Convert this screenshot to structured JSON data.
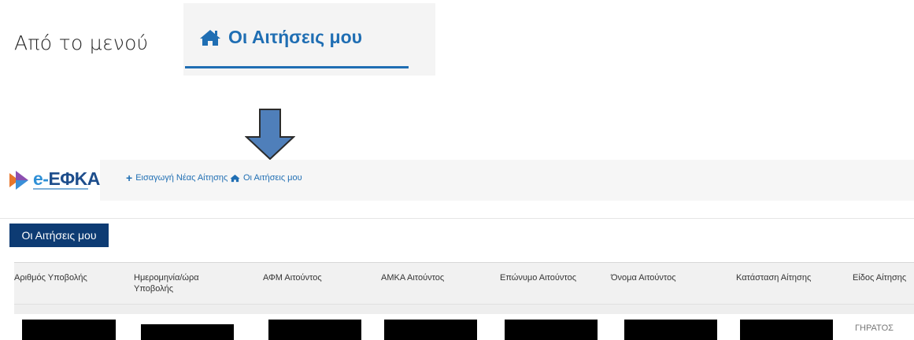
{
  "intro": {
    "text": "Από το μενού"
  },
  "zoom": {
    "label": "Οι Αιτήσεις μου"
  },
  "brand": {
    "logo_e": "e-",
    "logo_text": "ΕΦΚΑ"
  },
  "nav": {
    "new_application": "Εισαγωγή Νέας Αίτησης",
    "my_applications": "Οι Αιτήσεις μου"
  },
  "section": {
    "title_button": "Οι Αιτήσεις μου"
  },
  "table": {
    "headers": [
      "Αριθμός Υποβολής",
      "Ημερομηνία/ώρα Υποβολής",
      "ΑΦΜ Αιτούντος",
      "ΑΜΚΑ Αιτούντος",
      "Επώνυμο Αιτούντος",
      "Όνομα Αιτούντος",
      "Κατάσταση Αίτησης",
      "Είδος Αίτησης"
    ],
    "row1_type": "ΓΗΡΑΤΟΣ"
  },
  "colors": {
    "brand_blue": "#1f6eb3",
    "dark_navy": "#0d3b73",
    "arrow_fill": "#4f7fba"
  }
}
